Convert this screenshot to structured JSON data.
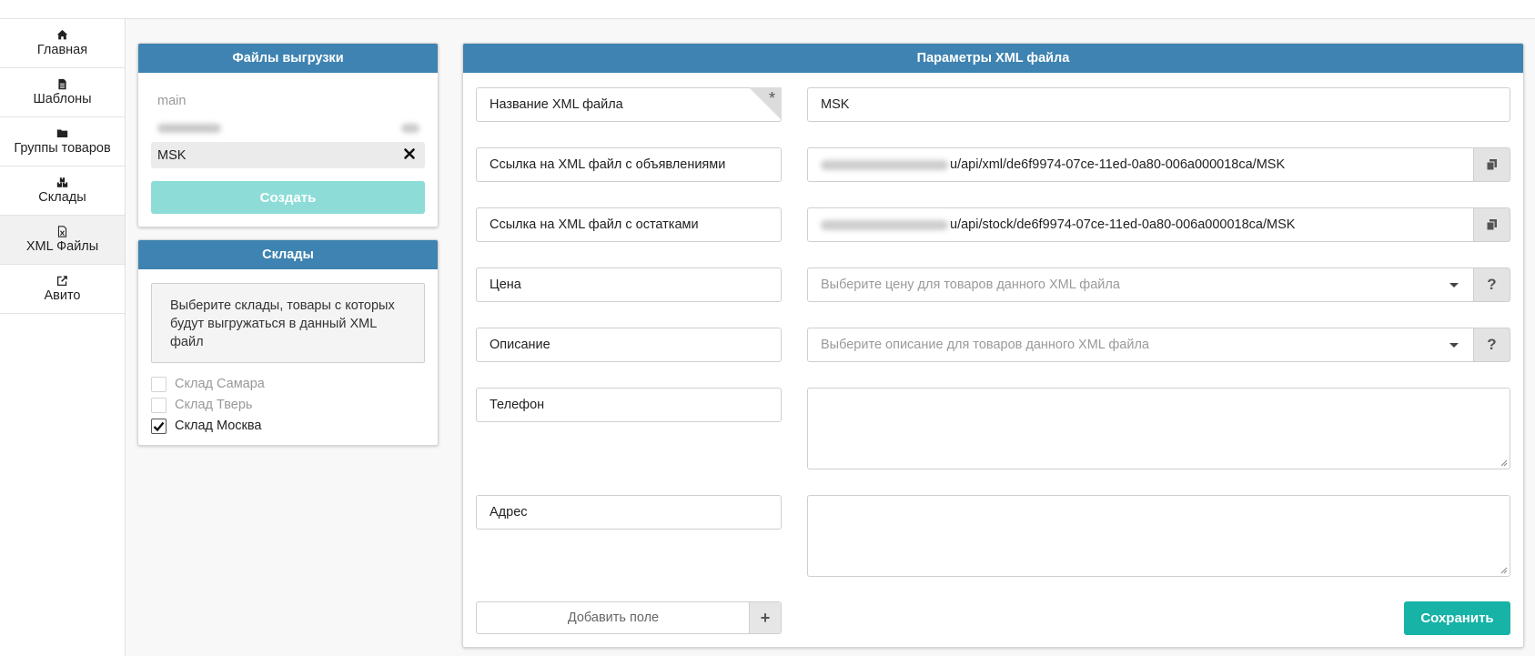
{
  "sidebar": {
    "items": [
      {
        "label": "Главная",
        "icon": "home-icon"
      },
      {
        "label": "Шаблоны",
        "icon": "file-icon"
      },
      {
        "label": "Группы товаров",
        "icon": "folder-icon"
      },
      {
        "label": "Склады",
        "icon": "boxes-icon"
      },
      {
        "label": "XML Файлы",
        "icon": "xml-file-icon",
        "active": true
      },
      {
        "label": "Авито",
        "icon": "external-link-icon"
      }
    ]
  },
  "files_panel": {
    "title": "Файлы выгрузки",
    "items": [
      "main",
      "MSK"
    ],
    "selected": "MSK",
    "create_label": "Создать"
  },
  "warehouses_panel": {
    "title": "Склады",
    "info": "Выберите склады, товары с которых будут выгружаться в данный XML файл",
    "items": [
      {
        "label": "Склад Самара",
        "checked": false
      },
      {
        "label": "Склад Тверь",
        "checked": false
      },
      {
        "label": "Склад Москва",
        "checked": true
      }
    ]
  },
  "xml_panel": {
    "title": "Параметры XML файла",
    "fields": {
      "name": {
        "label": "Название XML файла",
        "value": "MSK",
        "required_mark": "*"
      },
      "ads_link": {
        "label": "Ссылка на XML файл с объявлениями",
        "value": "u/api/xml/de6f9974-07ce-11ed-0a80-006a000018ca/MSK"
      },
      "stock_link": {
        "label": "Ссылка на XML файл с остатками",
        "value": "u/api/stock/de6f9974-07ce-11ed-0a80-006a000018ca/MSK"
      },
      "price": {
        "label": "Цена",
        "placeholder": "Выберите цену для товаров данного XML файла",
        "help": "?"
      },
      "description": {
        "label": "Описание",
        "placeholder": "Выберите описание для товаров данного XML файла",
        "help": "?"
      },
      "phone": {
        "label": "Телефон",
        "value": ""
      },
      "address": {
        "label": "Адрес",
        "value": ""
      }
    },
    "add_field_label": "Добавить поле",
    "add_field_icon": "+",
    "save_label": "Сохранить"
  },
  "colors": {
    "header": "#3e83b1",
    "create_button": "#8ddcd7",
    "save_button": "#16b3a6"
  }
}
